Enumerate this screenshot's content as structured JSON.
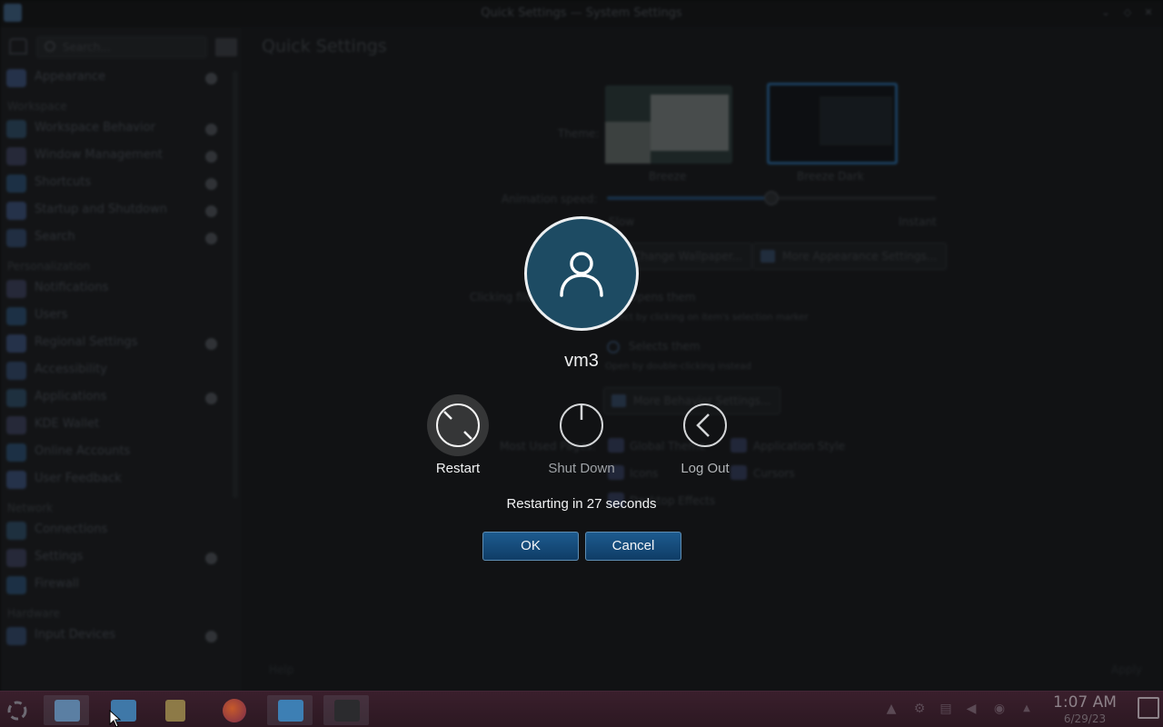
{
  "window": {
    "title": "Quick Settings — System Settings"
  },
  "sidebar": {
    "search_placeholder": "Search...",
    "items": [
      {
        "label": "Appearance",
        "dot": true
      },
      {
        "category": "Workspace"
      },
      {
        "label": "Workspace Behavior",
        "dot": true
      },
      {
        "label": "Window Management",
        "dot": true
      },
      {
        "label": "Shortcuts",
        "dot": true
      },
      {
        "label": "Startup and Shutdown",
        "dot": true
      },
      {
        "label": "Search",
        "dot": true
      },
      {
        "category": "Personalization"
      },
      {
        "label": "Notifications",
        "dot": false
      },
      {
        "label": "Users",
        "dot": false
      },
      {
        "label": "Regional Settings",
        "dot": true
      },
      {
        "label": "Accessibility",
        "dot": false
      },
      {
        "label": "Applications",
        "dot": true
      },
      {
        "label": "KDE Wallet",
        "dot": false
      },
      {
        "label": "Online Accounts",
        "dot": false
      },
      {
        "label": "User Feedback",
        "dot": false
      },
      {
        "category": "Network"
      },
      {
        "label": "Connections",
        "dot": false
      },
      {
        "label": "Settings",
        "dot": true
      },
      {
        "label": "Firewall",
        "dot": false
      },
      {
        "category": "Hardware"
      },
      {
        "label": "Input Devices",
        "dot": true
      }
    ]
  },
  "content": {
    "heading": "Quick Settings",
    "theme_label": "Theme:",
    "themes": [
      {
        "name": "Breeze",
        "selected": false
      },
      {
        "name": "Breeze Dark",
        "selected": true
      }
    ],
    "animation_label": "Animation speed:",
    "animation_min": "Slow",
    "animation_max": "Instant",
    "animation_value": 0.5,
    "change_wallpaper": "Change Wallpaper...",
    "more_appearance": "More Appearance Settings...",
    "clicking_label": "Clicking files or folders:",
    "opens_them": "Opens them",
    "opens_them_hint": "Select by clicking on item's selection marker",
    "selects_them": "Selects them",
    "selects_them_hint": "Open by double-clicking instead",
    "more_behavior": "More Behavior Settings...",
    "most_used_label": "Most Used Pages:",
    "most_used": [
      "Global Theme",
      "Application Style",
      "Icons",
      "Cursors",
      "Desktop Effects"
    ],
    "help": "Help",
    "apply": "Apply"
  },
  "dialog": {
    "username": "vm3",
    "actions": [
      {
        "label": "Restart",
        "selected": true
      },
      {
        "label": "Shut Down",
        "selected": false
      },
      {
        "label": "Log Out",
        "selected": false
      }
    ],
    "countdown": "Restarting in 27 seconds",
    "ok": "OK",
    "cancel": "Cancel"
  },
  "taskbar": {
    "items": [
      "app-launcher-icon",
      "system-settings-icon",
      "dolphin-icon",
      "file-manager-icon",
      "firefox-icon",
      "files-icon",
      "terminal-icon"
    ],
    "tray": [
      "vault-icon",
      "network-icon",
      "clipboard-icon",
      "volume-icon",
      "speaker-icon",
      "expand-tray-icon"
    ],
    "time": "1:07 AM",
    "date": "6/29/23"
  },
  "colors": {
    "accent": "#1d5b8f",
    "avatar_bg": "#1d4b63",
    "taskbar": "#3a1f2c"
  }
}
